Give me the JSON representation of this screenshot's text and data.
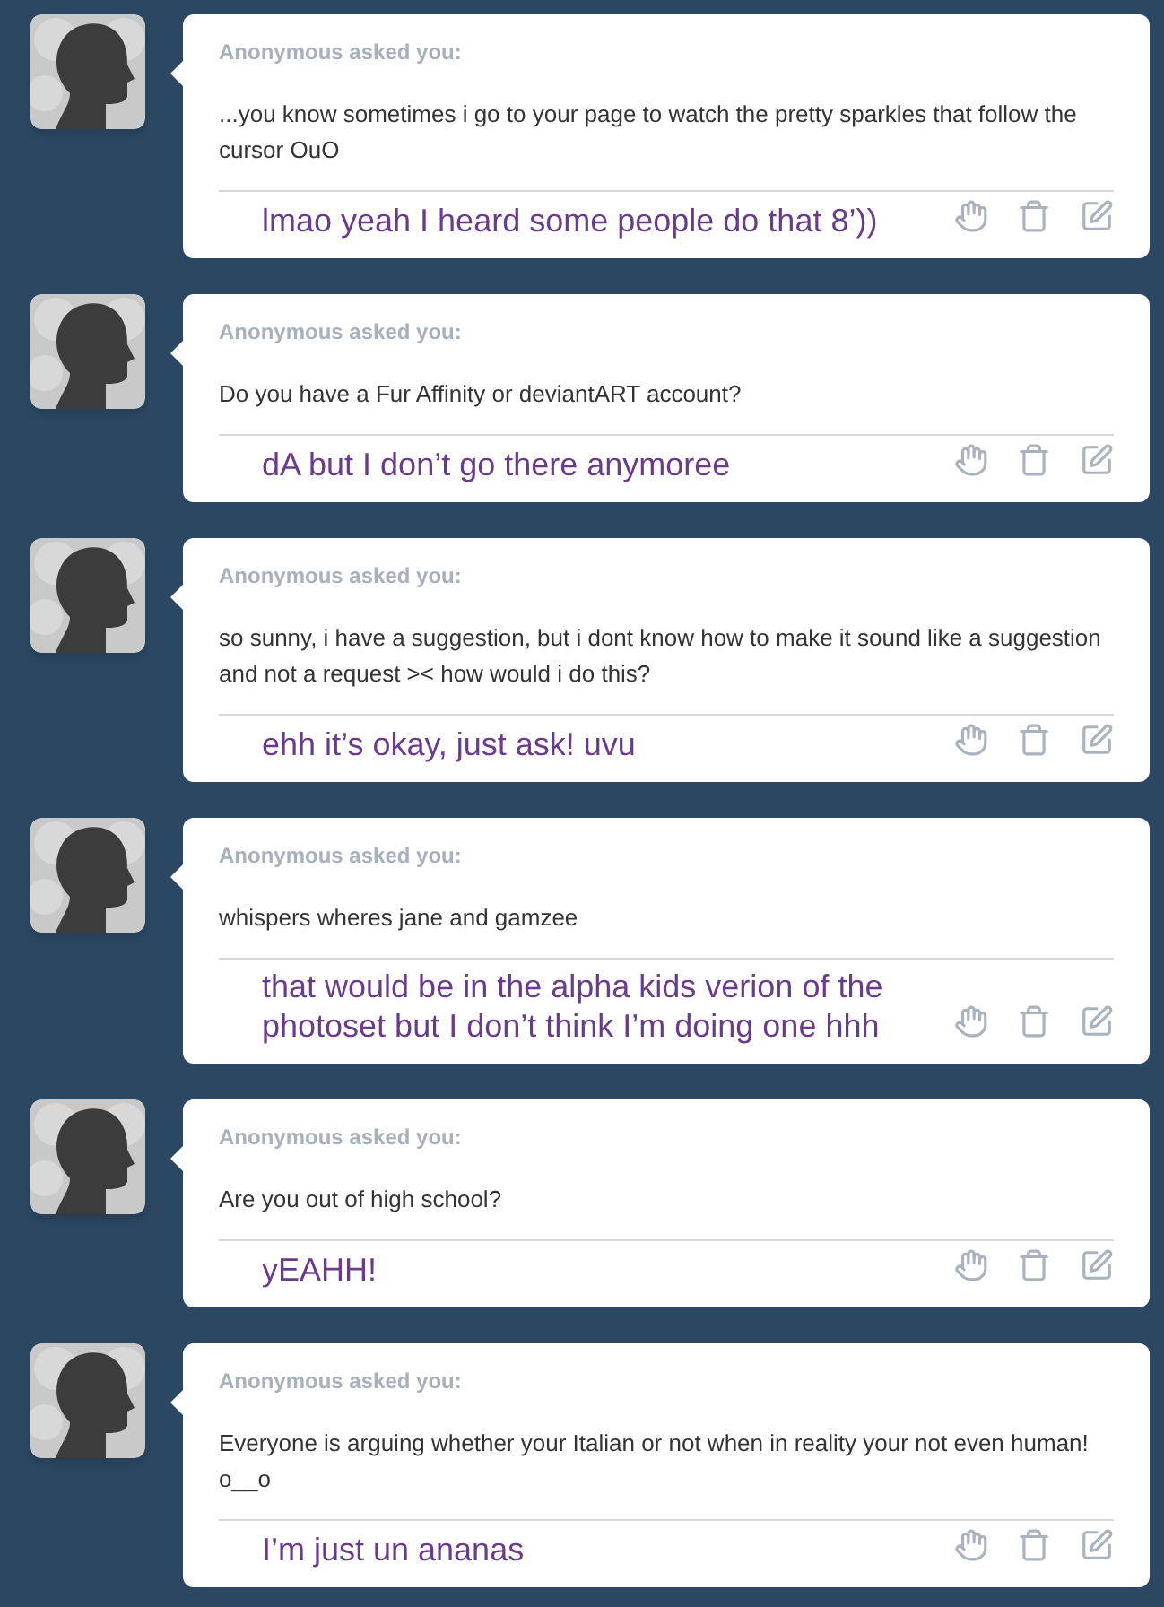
{
  "asks": [
    {
      "asker": "Anonymous asked you:",
      "question": "...you know sometimes i go to your page to watch the pretty sparkles that follow the cursor OuO",
      "reply": "lmao yeah I heard some people do that 8’))"
    },
    {
      "asker": "Anonymous asked you:",
      "question": "Do you have a Fur Affinity or deviantART account?",
      "reply": "dA but I don’t go there anymoree"
    },
    {
      "asker": "Anonymous asked you:",
      "question": "so sunny, i have a suggestion, but i dont know how to make it sound like a suggestion and not a request >< how would i do this?",
      "reply": "ehh it’s okay, just ask! uvu"
    },
    {
      "asker": "Anonymous asked you:",
      "question": "whispers wheres jane and gamzee",
      "reply": "that would be in the alpha kids verion of the photoset but I don’t think I’m doing one hhh"
    },
    {
      "asker": "Anonymous asked you:",
      "question": "Are you out of high school?",
      "reply": "yEAHH!"
    },
    {
      "asker": "Anonymous asked you:",
      "question": "Everyone is arguing whether your Italian or not when in reality your not even human! o__o",
      "reply": "I’m just un ananas"
    }
  ]
}
